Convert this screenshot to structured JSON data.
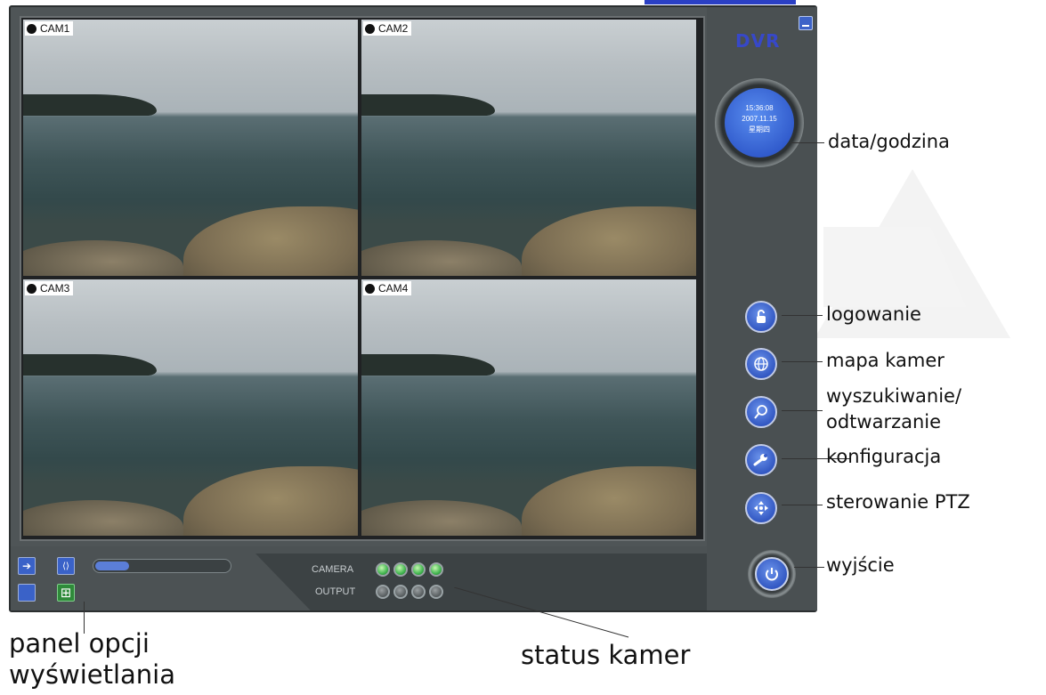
{
  "app": {
    "logo": "DVR"
  },
  "clock": {
    "time": "15:36:08",
    "date": "2007.11.15",
    "weekday": "星期四"
  },
  "cameras": [
    {
      "label": "CAM1"
    },
    {
      "label": "CAM2"
    },
    {
      "label": "CAM3"
    },
    {
      "label": "CAM4"
    }
  ],
  "status": {
    "camera_label": "CAMERA",
    "output_label": "OUTPUT",
    "camera_leds": [
      "on",
      "on",
      "on",
      "on"
    ],
    "output_leds": [
      "off",
      "off",
      "off",
      "off"
    ]
  },
  "display_panel": {
    "slider_level": 0.25
  },
  "annotations": {
    "datetime": "data/godzina",
    "login": "logowanie",
    "camera_map": "mapa kamer",
    "search_line1": "wyszukiwanie/",
    "search_line2": "odtwarzanie",
    "config": "konfiguracja",
    "ptz": "sterowanie PTZ",
    "exit": "wyjście",
    "display_options_line1": "panel opcji",
    "display_options_line2": "wyświetlania",
    "camera_status": "status kamer"
  },
  "colors": {
    "accent": "#2f54c0",
    "led_on": "#42b650",
    "panel": "#4f5557"
  }
}
